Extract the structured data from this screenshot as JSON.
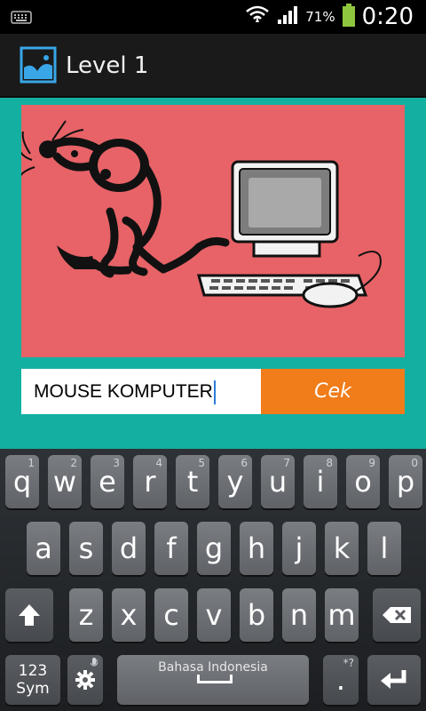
{
  "status_bar": {
    "icons": [
      "keyboard-icon",
      "wifi-icon",
      "signal-icon",
      "battery-icon"
    ],
    "battery_percent": "71%",
    "time": "0:20"
  },
  "action_bar": {
    "icon": "image-icon",
    "title": "Level 1"
  },
  "quiz": {
    "picture": "mouse-and-computer-illustration",
    "answer_value": "MOUSE KOMPUTER",
    "submit_label": "Cek"
  },
  "keyboard": {
    "row1": [
      {
        "key": "q",
        "sub": "1"
      },
      {
        "key": "w",
        "sub": "2"
      },
      {
        "key": "e",
        "sub": "3"
      },
      {
        "key": "r",
        "sub": "4"
      },
      {
        "key": "t",
        "sub": "5"
      },
      {
        "key": "y",
        "sub": "6"
      },
      {
        "key": "u",
        "sub": "7"
      },
      {
        "key": "i",
        "sub": "8"
      },
      {
        "key": "o",
        "sub": "9"
      },
      {
        "key": "p",
        "sub": "0"
      }
    ],
    "row2": [
      "a",
      "s",
      "d",
      "f",
      "g",
      "h",
      "j",
      "k",
      "l"
    ],
    "row3": [
      "z",
      "x",
      "c",
      "v",
      "b",
      "n",
      "m"
    ],
    "symbols_label_line1": "123",
    "symbols_label_line2": "Sym",
    "space_label": "Bahasa Indonesia",
    "period_label": ".",
    "period_sub": "*?",
    "settings_sub": "*"
  },
  "colors": {
    "content_background": "#13b0a2",
    "picture_background": "#e76367",
    "submit_button": "#f07c1a",
    "cursor": "#2a7cd8"
  }
}
